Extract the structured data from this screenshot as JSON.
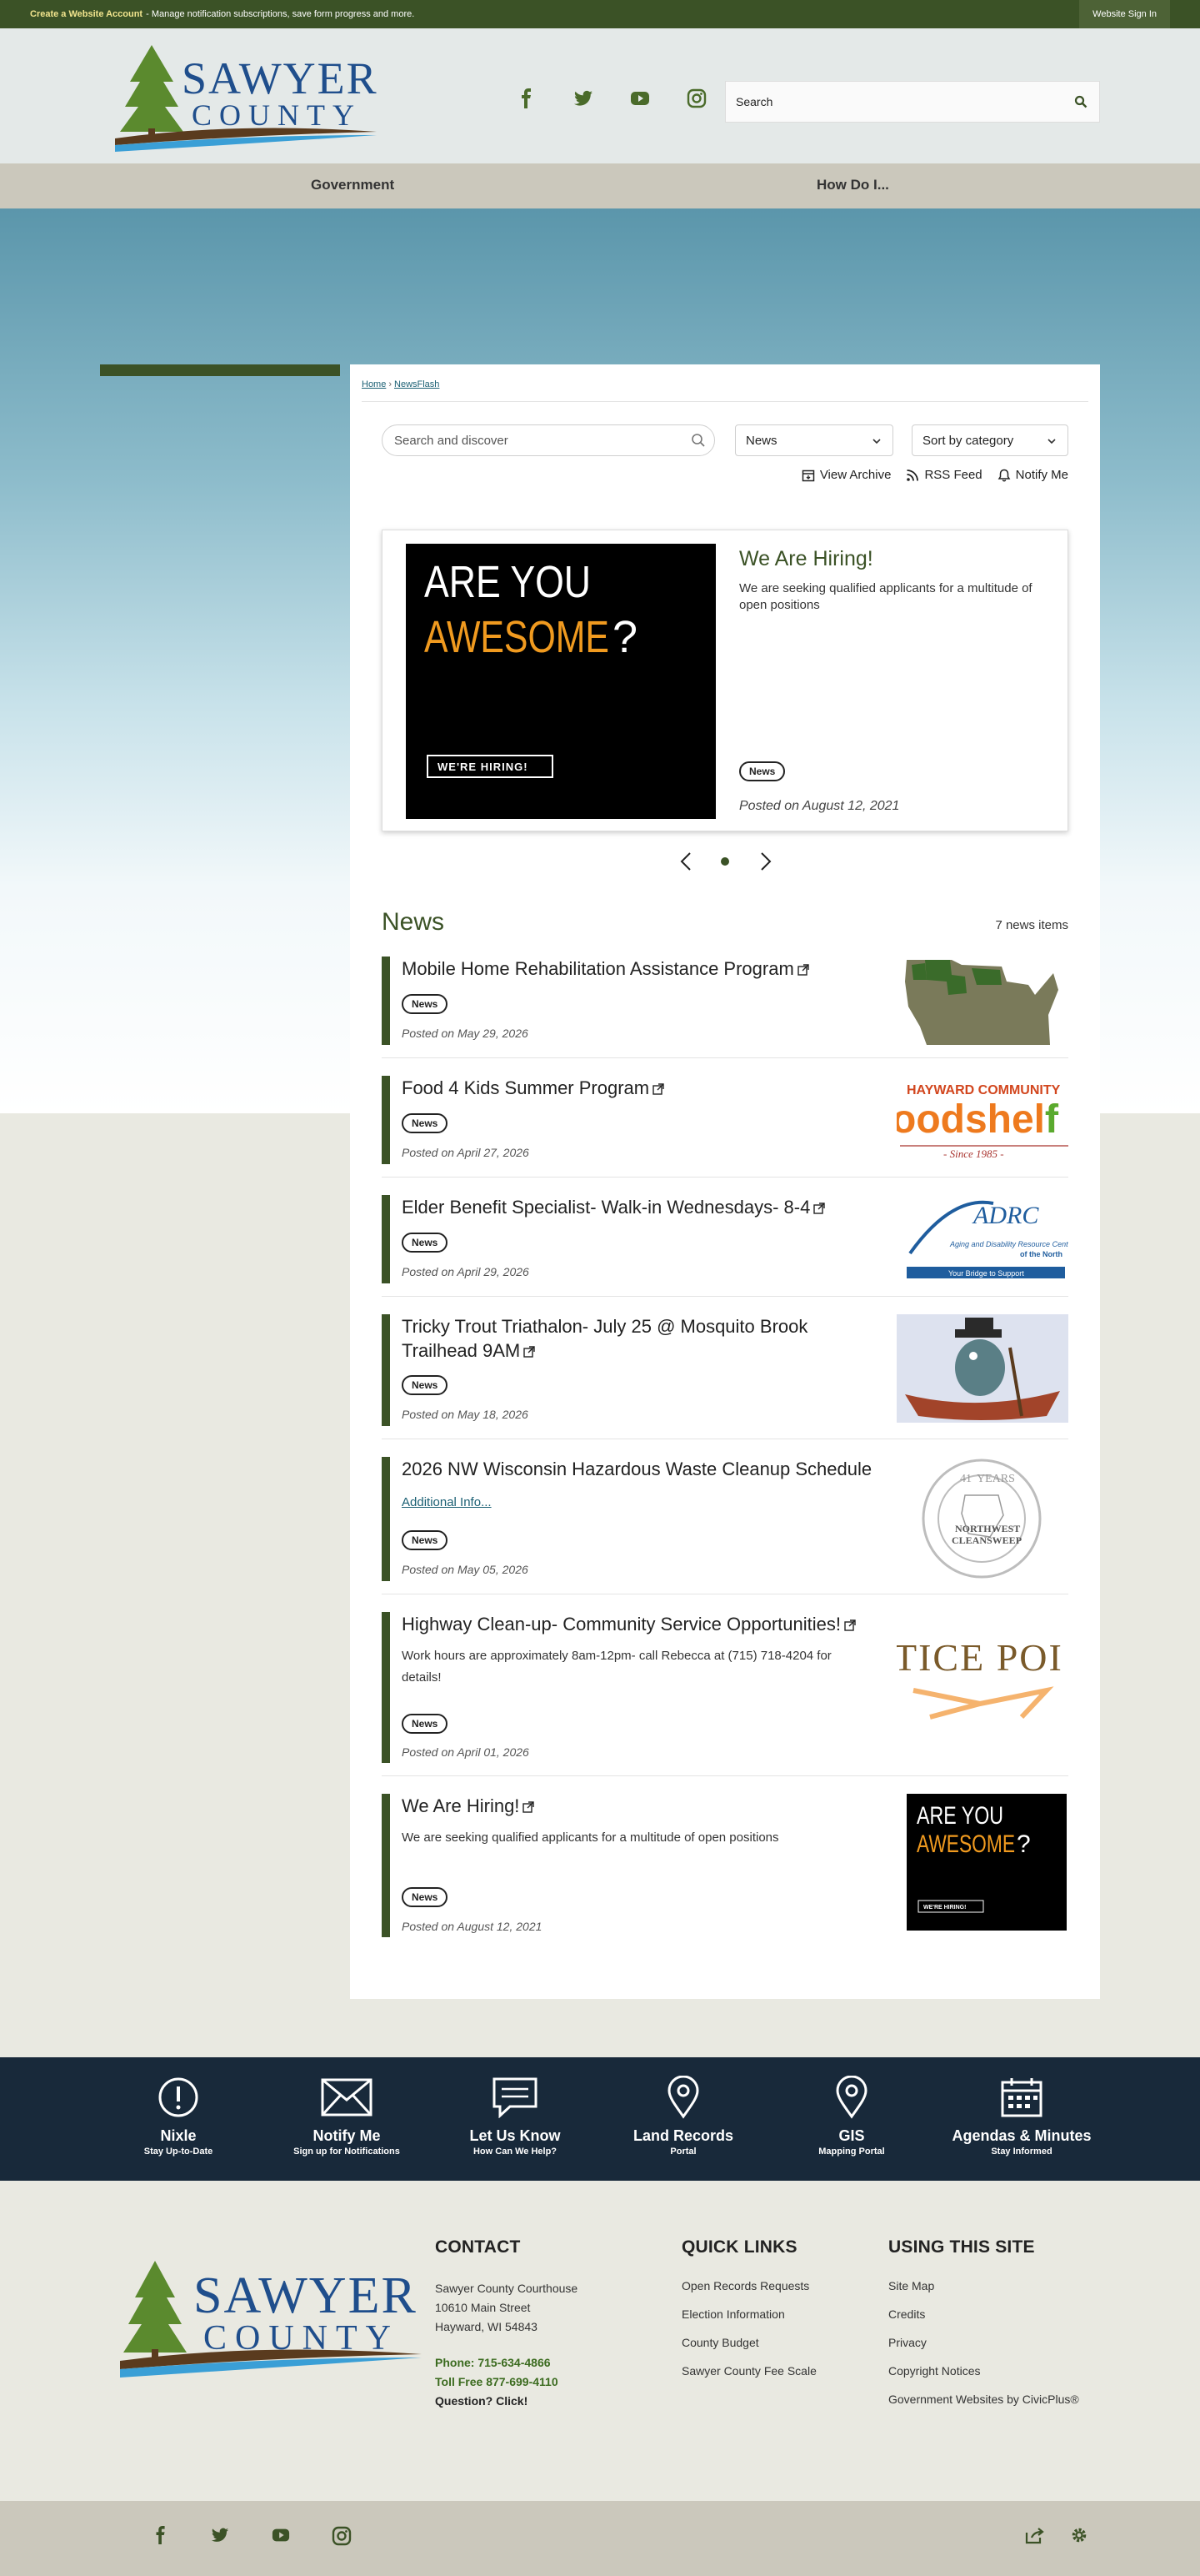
{
  "topbar": {
    "create_link": "Create a Website Account",
    "create_text": "- Manage notification subscriptions, save form progress and more.",
    "signin": "Website Sign In"
  },
  "logo": {
    "line1": "SAWYER",
    "line2": "COUNTY"
  },
  "header": {
    "social": [
      "facebook-icon",
      "twitter-icon",
      "youtube-icon",
      "instagram-icon"
    ],
    "search_placeholder": "Search"
  },
  "nav": {
    "items": [
      "Government",
      "How Do I..."
    ]
  },
  "breadcrumb": {
    "home": "Home",
    "current": "NewsFlash",
    "sep": "›"
  },
  "filters": {
    "search_placeholder": "Search and discover",
    "category": "News",
    "sort": "Sort by category",
    "view_archive": "View Archive",
    "rss": "RSS Feed",
    "notify": "Notify Me"
  },
  "featured": {
    "image_line1": "ARE YOU",
    "image_line2": "AWESOME",
    "image_q": "?",
    "image_tag": "WE'RE HIRING!",
    "title": "We Are Hiring!",
    "desc": "We are seeking qualified applicants for a multitude of open positions",
    "badge": "News",
    "date": "Posted on August 12, 2021"
  },
  "news": {
    "heading": "News",
    "count": "7 news items",
    "items": [
      {
        "title": "Mobile Home Rehabilitation Assistance Program",
        "badge": "News",
        "date": "Posted on May 29, 2026"
      },
      {
        "title": "Food 4 Kids Summer Program",
        "badge": "News",
        "date": "Posted on April 27, 2026",
        "thumb_top": "HAYWARD COMMUNITY",
        "thumb_main": "oodshelf",
        "thumb_f": "f",
        "thumb_since": "- Since 1985 -"
      },
      {
        "title": "Elder Benefit Specialist- Walk-in Wednesdays- 8-4",
        "badge": "News",
        "date": "Posted on April 29, 2026",
        "thumb_main": "ADRC",
        "thumb_sub": "Aging and Disability Resource Center",
        "thumb_sub2": "of the North",
        "thumb_bar": "Your Bridge to Support"
      },
      {
        "title": "Tricky Trout Triathalon- July 25 @ Mosquito Brook Trailhead 9AM",
        "badge": "News",
        "date": "Posted on May 18, 2026"
      },
      {
        "title": "2026 NW Wisconsin Hazardous Waste Cleanup Schedule",
        "link": "Additional Info...",
        "badge": "News",
        "date": "Posted on May 05, 2026",
        "thumb_years": "YEARS",
        "thumb_num": "41",
        "thumb_main": "NORTHWEST",
        "thumb_sub": "CLEANSWEEP"
      },
      {
        "title": "Highway Clean-up- Community Service Opportunities!",
        "desc": "Work hours are approximately 8am-12pm- call Rebecca at (715) 718-4204 for details!",
        "badge": "News",
        "date": "Posted on April 01, 2026",
        "thumb_main": "TICE POI"
      },
      {
        "title": "We Are Hiring!",
        "desc": "We are seeking qualified applicants for a multitude of open positions",
        "badge": "News",
        "date": "Posted on August 12, 2021"
      }
    ]
  },
  "quickbar": [
    {
      "icon": "alert-icon",
      "label": "Nixle",
      "sub": "Stay Up-to-Date"
    },
    {
      "icon": "envelope-icon",
      "label": "Notify Me",
      "sub": "Sign up for Notifications"
    },
    {
      "icon": "chat-icon",
      "label": "Let Us Know",
      "sub": "How Can We Help?"
    },
    {
      "icon": "map-pin-icon",
      "label": "Land Records",
      "sub": "Portal"
    },
    {
      "icon": "map-pin-icon",
      "label": "GIS",
      "sub": "Mapping Portal"
    },
    {
      "icon": "calendar-icon",
      "label": "Agendas & Minutes",
      "sub": "Stay Informed"
    }
  ],
  "footer": {
    "contact": {
      "heading": "CONTACT",
      "line1": "Sawyer County Courthouse",
      "line2": "10610 Main Street",
      "line3": "Hayward, WI 54843",
      "phone": "Phone: 715-634-4866",
      "tollfree": "Toll Free 877-699-4110",
      "question": "Question? Click!"
    },
    "quick_links": {
      "heading": "QUICK LINKS",
      "items": [
        "Open Records Requests",
        "Election Information",
        "County Budget",
        "Sawyer County Fee Scale"
      ]
    },
    "using": {
      "heading": "USING THIS SITE",
      "items": [
        "Site Map",
        "Credits",
        "Privacy",
        "Copyright Notices",
        "Government Websites by CivicPlus®"
      ]
    }
  },
  "colors": {
    "brand_green": "#3b5226",
    "navy": "#18293a",
    "logo_blue": "#1f4e8c"
  }
}
